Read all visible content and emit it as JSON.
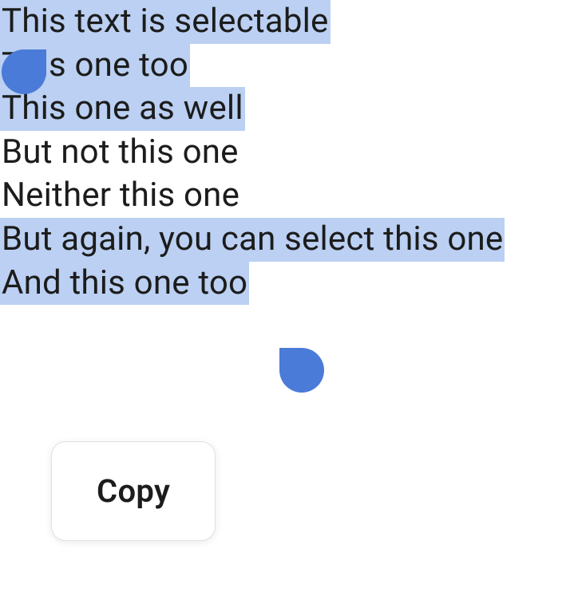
{
  "lines": [
    {
      "text": "This text is selectable",
      "highlighted": true
    },
    {
      "text": "This one too",
      "highlighted": true
    },
    {
      "text": "This one as well",
      "highlighted": true
    },
    {
      "text": "But not this one",
      "highlighted": false
    },
    {
      "text": "Neither this one",
      "highlighted": false
    },
    {
      "text": "But again, you can select this one",
      "highlighted": true
    },
    {
      "text": "And this one too",
      "highlighted": true
    }
  ],
  "popup": {
    "copy_label": "Copy"
  },
  "colors": {
    "highlight": "#bbd0f2",
    "handle": "#4a7bd8"
  }
}
